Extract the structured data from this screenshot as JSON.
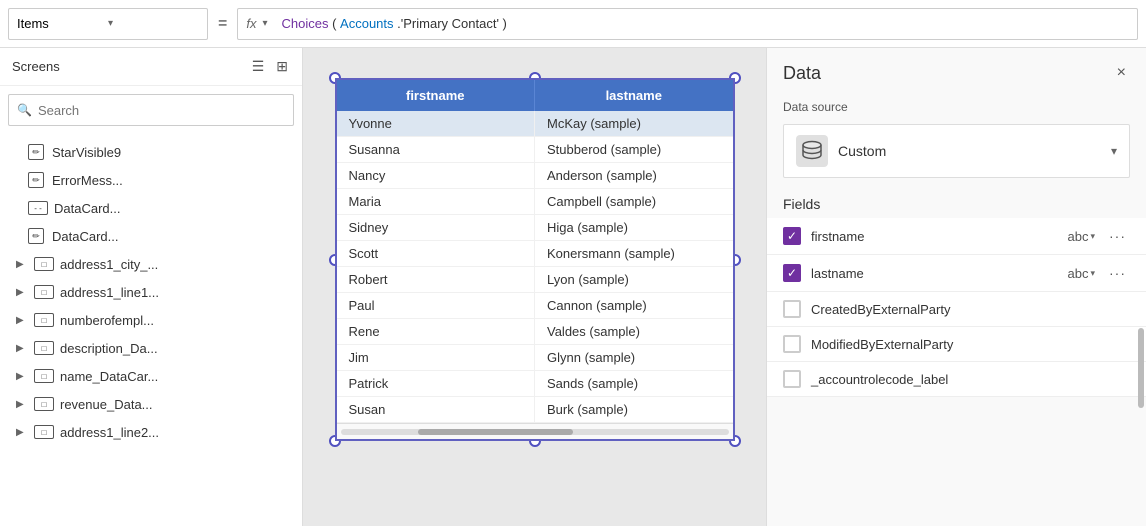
{
  "topbar": {
    "items_label": "Items",
    "equals": "=",
    "fx_label": "fx",
    "formula": {
      "choices": "Choices",
      "paren_open": "( ",
      "accounts": "Accounts",
      "dot_field": ".'Primary Contact'",
      "paren_close": " )"
    }
  },
  "sidebar": {
    "title": "Screens",
    "search_placeholder": "Search",
    "items": [
      {
        "id": "star-visible9",
        "label": "StarVisible9",
        "icon": "edit-square",
        "indent": 1
      },
      {
        "id": "error-mess",
        "label": "ErrorMess...",
        "icon": "edit-square",
        "indent": 1
      },
      {
        "id": "data-card1",
        "label": "DataCard...",
        "icon": "rect-dash",
        "indent": 1
      },
      {
        "id": "data-card2",
        "label": "DataCard...",
        "icon": "edit-square",
        "indent": 1
      },
      {
        "id": "address1-city",
        "label": "address1_city_...",
        "icon": "rect",
        "indent": 0,
        "expand": true
      },
      {
        "id": "address1-line1",
        "label": "address1_line1...",
        "icon": "rect",
        "indent": 0,
        "expand": true
      },
      {
        "id": "numberofempl",
        "label": "numberofempl...",
        "icon": "rect",
        "indent": 0,
        "expand": true
      },
      {
        "id": "description-da",
        "label": "description_Da...",
        "icon": "rect",
        "indent": 0,
        "expand": true
      },
      {
        "id": "name-datacar",
        "label": "name_DataCar...",
        "icon": "rect",
        "indent": 0,
        "expand": true
      },
      {
        "id": "revenue-data",
        "label": "revenue_Data...",
        "icon": "rect",
        "indent": 0,
        "expand": true
      },
      {
        "id": "address1-line2",
        "label": "address1_line2...",
        "icon": "rect",
        "indent": 0,
        "expand": true
      }
    ]
  },
  "canvas": {
    "table": {
      "columns": [
        "firstname",
        "lastname"
      ],
      "rows": [
        [
          "Yvonne",
          "McKay (sample)"
        ],
        [
          "Susanna",
          "Stubberod (sample)"
        ],
        [
          "Nancy",
          "Anderson (sample)"
        ],
        [
          "Maria",
          "Campbell (sample)"
        ],
        [
          "Sidney",
          "Higa (sample)"
        ],
        [
          "Scott",
          "Konersmann (sample)"
        ],
        [
          "Robert",
          "Lyon (sample)"
        ],
        [
          "Paul",
          "Cannon (sample)"
        ],
        [
          "Rene",
          "Valdes (sample)"
        ],
        [
          "Jim",
          "Glynn (sample)"
        ],
        [
          "Patrick",
          "Sands (sample)"
        ],
        [
          "Susan",
          "Burk (sample)"
        ]
      ]
    }
  },
  "right_panel": {
    "title": "Data",
    "close_icon": "×",
    "datasource_label": "Data source",
    "datasource_name": "Custom",
    "datasource_icon": "🗄",
    "fields_label": "Fields",
    "fields": [
      {
        "id": "firstname",
        "name": "firstname",
        "checked": true,
        "type": "abc"
      },
      {
        "id": "lastname",
        "name": "lastname",
        "checked": true,
        "type": "abc"
      },
      {
        "id": "created-by-external",
        "name": "CreatedByExternalParty",
        "checked": false,
        "type": ""
      },
      {
        "id": "modified-by-external",
        "name": "ModifiedByExternalParty",
        "checked": false,
        "type": ""
      },
      {
        "id": "accountrolecode",
        "name": "_accountrolecode_label",
        "checked": false,
        "type": ""
      }
    ]
  }
}
